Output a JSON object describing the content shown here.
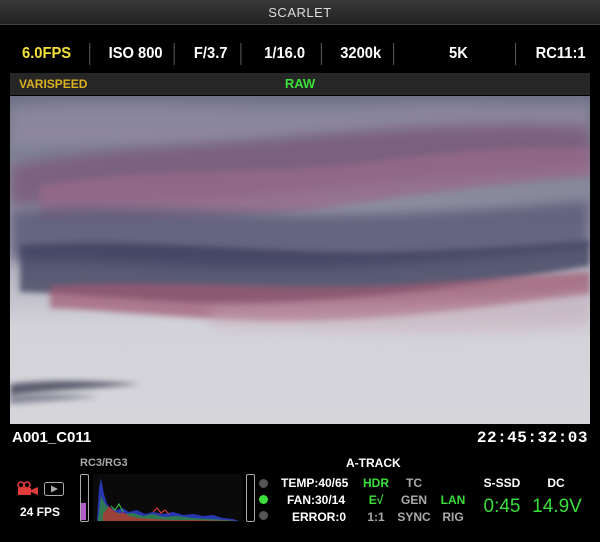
{
  "window": {
    "title": "SCARLET"
  },
  "params": [
    {
      "key": "framerate",
      "label": "6.0FPS",
      "color": "#f2e13a"
    },
    {
      "key": "iso",
      "label": "ISO 800"
    },
    {
      "key": "aperture",
      "label": "F/3.7"
    },
    {
      "key": "shutter",
      "label": "1/16.0"
    },
    {
      "key": "white_balance",
      "label": "3200k"
    },
    {
      "key": "resolution",
      "label": "5K"
    },
    {
      "key": "redcode",
      "label": "RC11:1"
    }
  ],
  "status": {
    "varispeed": "VARISPEED",
    "format": "RAW"
  },
  "clip": {
    "name": "A001_C011",
    "timecode": "22:45:32:03"
  },
  "bottom": {
    "camera_icon": "record-camera-icon",
    "play_icon": "playback-icon",
    "project_fps": "24 FPS",
    "color_space": "RC3/RG3",
    "audio_meter_left_level": 0.37,
    "audio_meter_right_level": 0.0,
    "indicators": [
      {
        "state": "off"
      },
      {
        "state": "on",
        "color": "#3adf3a"
      },
      {
        "state": "off"
      }
    ],
    "temp": "TEMP:40/65",
    "fan": "FAN:30/14",
    "error": "ERROR:0",
    "a_track": "A-TRACK",
    "hdr": "HDR",
    "ev": "E√",
    "ratio": "1:1",
    "tc": "TC",
    "gen": "GEN",
    "sync": "SYNC",
    "lan": "LAN",
    "rig": "RIG",
    "media_label": "S-SSD",
    "media_time": "0:45",
    "power_label": "DC",
    "power_value": "14.9V"
  }
}
